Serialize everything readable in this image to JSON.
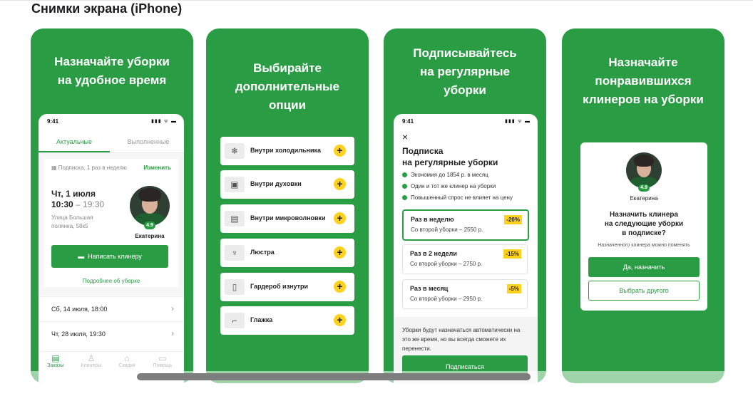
{
  "section_title": "Снимки экрана (iPhone)",
  "status_time": "9:41",
  "status_icons": "▮▮▮ ᯤ ▬",
  "cards": [
    {
      "title_lines": [
        "Назначайте уборки",
        "на удобное время"
      ]
    },
    {
      "title_lines": [
        "Выбирайте",
        "дополнительные",
        "опции"
      ]
    },
    {
      "title_lines": [
        "Подписывайтесь",
        "на регулярные",
        "уборки"
      ]
    },
    {
      "title_lines": [
        "Назначайте",
        "понравившихся",
        "клинеров на уборки"
      ]
    }
  ],
  "orders": {
    "tabs": [
      "Актуальные",
      "Выполненные"
    ],
    "subscription_note": "Подписка, 1 раз в неделю",
    "change_link": "Изменить",
    "date": "Чт, 1 июля",
    "time_start": "10:30",
    "time_end": "– 19:30",
    "address_lines": [
      "Улица Большая",
      "полянка, 58к5"
    ],
    "cleaner_name": "Екатерина",
    "rating": "4.9",
    "write_button": "Написать клинеру",
    "details_link": "Подробнее об уборке",
    "upcoming": [
      "Сб, 14 июля, 18:00",
      "Чт, 28 июля, 19:30"
    ],
    "nav": [
      {
        "icon": "orders-icon",
        "glyph": "▤",
        "label": "Заказы"
      },
      {
        "icon": "cleaners-icon",
        "glyph": "♙",
        "label": "Клинеры"
      },
      {
        "icon": "gift-icon",
        "glyph": "⌂",
        "label": "Скидки"
      },
      {
        "icon": "chat-icon",
        "glyph": "▭",
        "label": "Помощь"
      }
    ]
  },
  "options": [
    {
      "label": "Внутри холодильника",
      "icon": "fridge-icon",
      "glyph": "❄"
    },
    {
      "label": "Внутри духовки",
      "icon": "oven-icon",
      "glyph": "▣"
    },
    {
      "label": "Внутри микроволновки",
      "icon": "microwave-icon",
      "glyph": "▤"
    },
    {
      "label": "Люстра",
      "icon": "chandelier-icon",
      "glyph": "♆"
    },
    {
      "label": "Гардероб изнутри",
      "icon": "wardrobe-icon",
      "glyph": "▯"
    },
    {
      "label": "Глажка",
      "icon": "iron-icon",
      "glyph": "⌐"
    }
  ],
  "subscription": {
    "title_lines": [
      "Подписка",
      "на регулярные уборки"
    ],
    "bullets": [
      "Экономия до 1854 р. в месяц",
      "Один и тот же клинер на уборки",
      "Повышенный спрос не влияет на цену"
    ],
    "plans": [
      {
        "name": "Раз в неделю",
        "price": "Со второй уборки – 2550 р.",
        "discount": "-20%"
      },
      {
        "name": "Раз в 2 недели",
        "price": "Со второй уборки – 2750 р.",
        "discount": "-15%"
      },
      {
        "name": "Раз в месяц",
        "price": "Со второй уборки – 2950 р.",
        "discount": "-5%"
      }
    ],
    "note": "Уборки будут назначаться автоматически на это же время, но вы всегда сможете их перенести.",
    "subscribe_button": "Подписаться",
    "selected_plan": 0
  },
  "assign": {
    "cleaner_name": "Екатерина",
    "rating": "4.9",
    "question_lines": [
      "Назначить клинера",
      "на следующие уборки",
      "в подписке?"
    ],
    "hint": "Назначенного клинера можно поменять",
    "yes_button": "Да, назначить",
    "other_button": "Выбрать другого"
  },
  "colors": {
    "brand_green": "#2a9d44",
    "accent_yellow": "#ffd21f"
  }
}
